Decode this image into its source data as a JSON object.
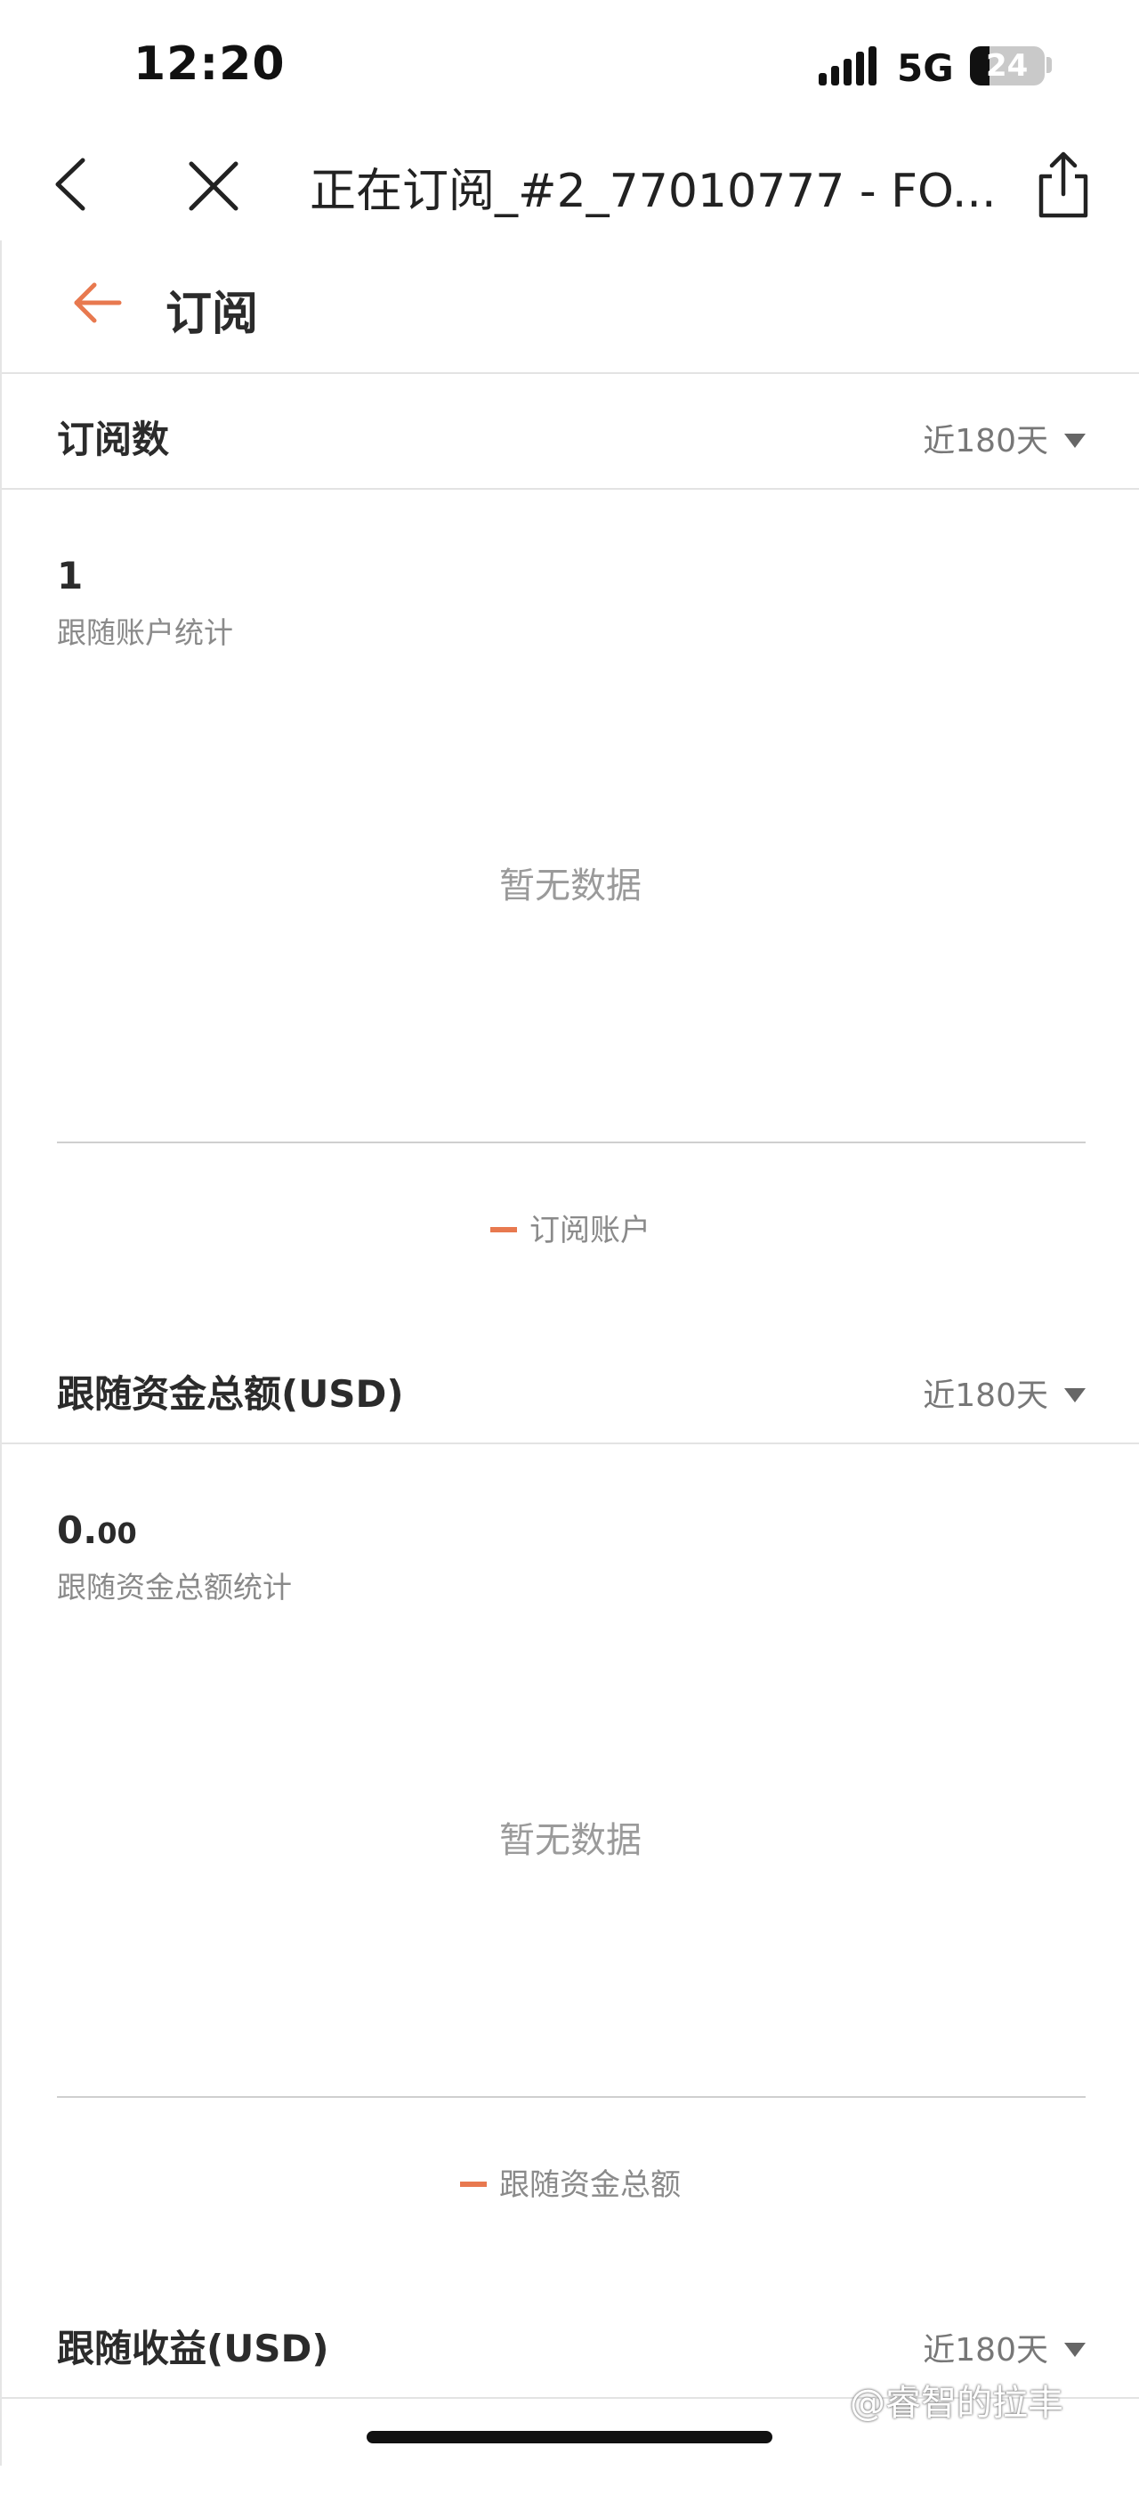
{
  "status_bar": {
    "time": "12:20",
    "network": "5G",
    "battery": "24"
  },
  "browser": {
    "title": "正在订阅_#2_77010777 - FO..."
  },
  "page": {
    "title": "订阅"
  },
  "cards": [
    {
      "title": "订阅数",
      "range": "近180天",
      "value": "1",
      "value_int": "1",
      "value_dec": "",
      "label": "跟随账户统计",
      "empty": "暂无数据",
      "legend": "订阅账户"
    },
    {
      "title": "跟随资金总额(USD)",
      "range": "近180天",
      "value_int": "0.",
      "value_dec": "00",
      "label": "跟随资金总额统计",
      "empty": "暂无数据",
      "legend": "跟随资金总额"
    },
    {
      "title": "跟随收益(USD)",
      "range": "近180天"
    }
  ],
  "watermark": "@睿智的拉丰",
  "colors": {
    "accent": "#e8794f",
    "text": "#2b2b2b",
    "muted": "#8a8a8a",
    "background": "#ececec"
  }
}
